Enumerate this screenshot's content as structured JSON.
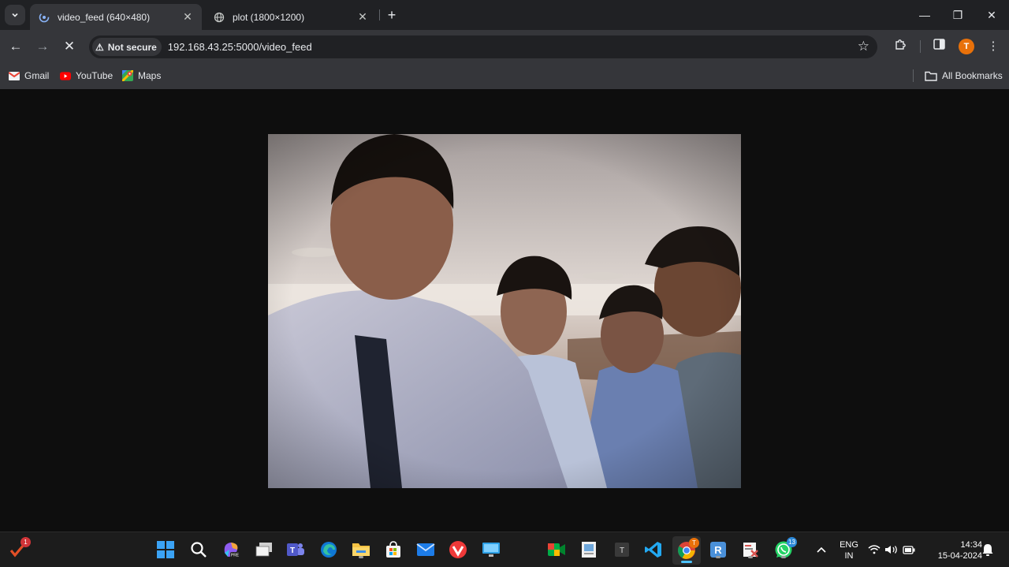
{
  "browser": {
    "tabs": [
      {
        "title": "video_feed (640×480)",
        "active": true
      },
      {
        "title": "plot (1800×1200)",
        "active": false
      }
    ],
    "new_tab": "+",
    "security_label": "Not secure",
    "url": "192.168.43.25:5000/video_feed",
    "profile_initial": "T",
    "bookmarks": [
      {
        "label": "Gmail",
        "icon": "gmail-icon"
      },
      {
        "label": "YouTube",
        "icon": "youtube-icon"
      },
      {
        "label": "Maps",
        "icon": "maps-icon"
      }
    ],
    "all_bookmarks": "All Bookmarks"
  },
  "taskbar": {
    "widget_badge": "1",
    "chrome_badge": "T",
    "whatsapp_badge": "13",
    "teams_letter": "T",
    "typora_letter": "T",
    "lang_line1": "ENG",
    "lang_line2": "IN",
    "time": "14:34",
    "date": "15-04-2024"
  },
  "colors": {
    "tabbar_bg": "#202124",
    "toolbar_bg": "#35363a",
    "page_bg": "#0e0e0e",
    "taskbar_bg": "#1c1c1c",
    "profile_accent": "#e8710a"
  }
}
